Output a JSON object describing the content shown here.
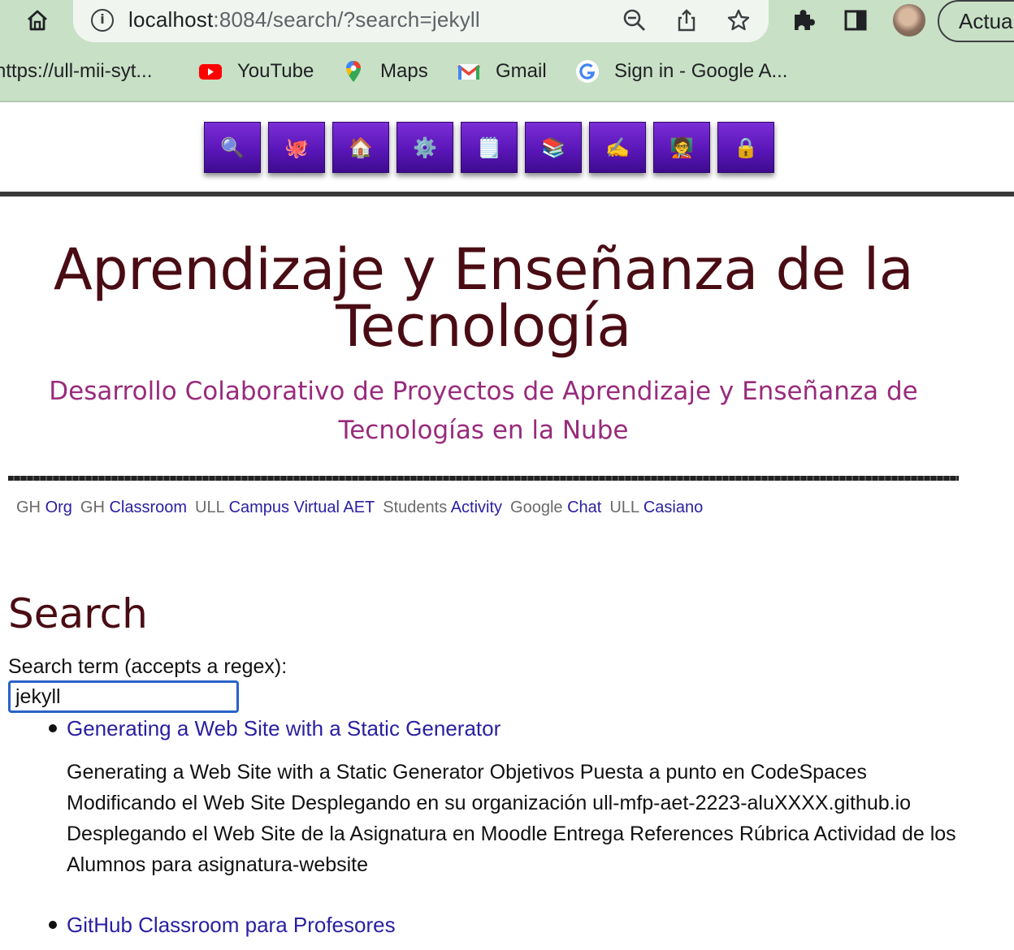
{
  "browser": {
    "url_host": "localhost",
    "url_rest": ":8084/search/?search=jekyll",
    "update_button_label": "Actua",
    "bookmarks": [
      {
        "label": "https://ull-mii-syt...",
        "icon": "page-icon"
      },
      {
        "label": "YouTube",
        "icon": "youtube-icon"
      },
      {
        "label": "Maps",
        "icon": "maps-icon"
      },
      {
        "label": "Gmail",
        "icon": "gmail-icon"
      },
      {
        "label": "Sign in - Google A...",
        "icon": "google-icon"
      }
    ]
  },
  "nav": {
    "buttons": [
      {
        "icon": "search-icon",
        "glyph": "🔍"
      },
      {
        "icon": "octopus-icon",
        "glyph": "🐙"
      },
      {
        "icon": "house-icon",
        "glyph": "🏠"
      },
      {
        "icon": "gear-icon",
        "glyph": "⚙️"
      },
      {
        "icon": "notepad-icon",
        "glyph": "🗒️"
      },
      {
        "icon": "books-icon",
        "glyph": "📚"
      },
      {
        "icon": "writing-hand-icon",
        "glyph": "✍️"
      },
      {
        "icon": "teacher-icon",
        "glyph": "🧑‍🏫"
      },
      {
        "icon": "lock-icon",
        "glyph": "🔒"
      }
    ]
  },
  "site": {
    "title": "Aprendizaje y Enseñanza de la Tecnología",
    "subtitle": "Desarrollo Colaborativo de Proyectos de Aprendizaje y Enseñanza de Tecnologías en la Nube"
  },
  "links": [
    {
      "prefix": "GH",
      "text": "Org"
    },
    {
      "prefix": "GH",
      "text": "Classroom"
    },
    {
      "prefix": "ULL",
      "text": "Campus Virtual AET"
    },
    {
      "prefix": "Students",
      "text": "Activity"
    },
    {
      "prefix": "Google",
      "text": "Chat"
    },
    {
      "prefix": "ULL",
      "text": "Casiano"
    }
  ],
  "search": {
    "heading": "Search",
    "label": "Search term (accepts a regex):",
    "value": "jekyll"
  },
  "results": [
    {
      "title": "Generating a Web Site with a Static Generator",
      "snippet": "Generating a Web Site with a Static Generator Objetivos Puesta a punto en CodeSpaces Modificando el Web Site Desplegando en su organización ull-mfp-aet-2223-aluXXXX.github.io Desplegando el Web Site de la Asignatura en Moodle Entrega References Rúbrica Actividad de los Alumnos para asignatura-website"
    },
    {
      "title": "GitHub Classroom para Profesores",
      "snippet": ""
    }
  ],
  "colors": {
    "chrome_bg": "#c8e0c6",
    "nav_button": "#5a16b8",
    "title": "#4a0c14",
    "subtitle": "#982b7c",
    "link": "#2a1fa0",
    "input_focus": "#2a62c9"
  }
}
